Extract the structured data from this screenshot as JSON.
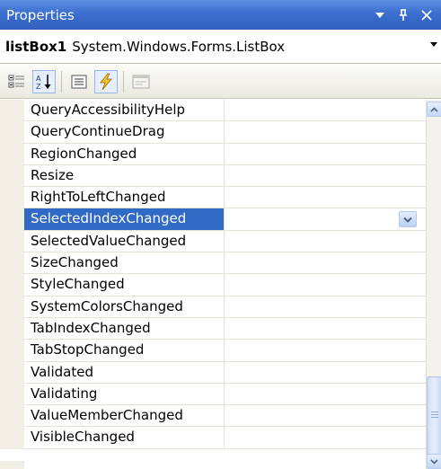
{
  "titlebar": {
    "title": "Properties",
    "dropdown_glyph": "▾",
    "pin_glyph": "ᵠ",
    "close_glyph": "✕"
  },
  "object_selector": {
    "name": "listBox1",
    "type": "System.Windows.Forms.ListBox"
  },
  "toolbar": {
    "buttons": [
      {
        "name": "categorized-icon",
        "active": false
      },
      {
        "name": "alphabetical-icon",
        "active": true
      },
      {
        "name": "properties-icon",
        "active": false
      },
      {
        "name": "events-icon",
        "active": true
      },
      {
        "name": "property-pages-icon",
        "active": false
      }
    ]
  },
  "events": [
    "QueryAccessibilityHelp",
    "QueryContinueDrag",
    "RegionChanged",
    "Resize",
    "RightToLeftChanged",
    "SelectedIndexChanged",
    "SelectedValueChanged",
    "SizeChanged",
    "StyleChanged",
    "SystemColorsChanged",
    "TabIndexChanged",
    "TabStopChanged",
    "Validated",
    "Validating",
    "ValueMemberChanged",
    "VisibleChanged"
  ],
  "selected_index": 5,
  "colors": {
    "titlebar": "#3c6fcf",
    "selection": "#316ac5",
    "gutter": "#f1efe6"
  }
}
